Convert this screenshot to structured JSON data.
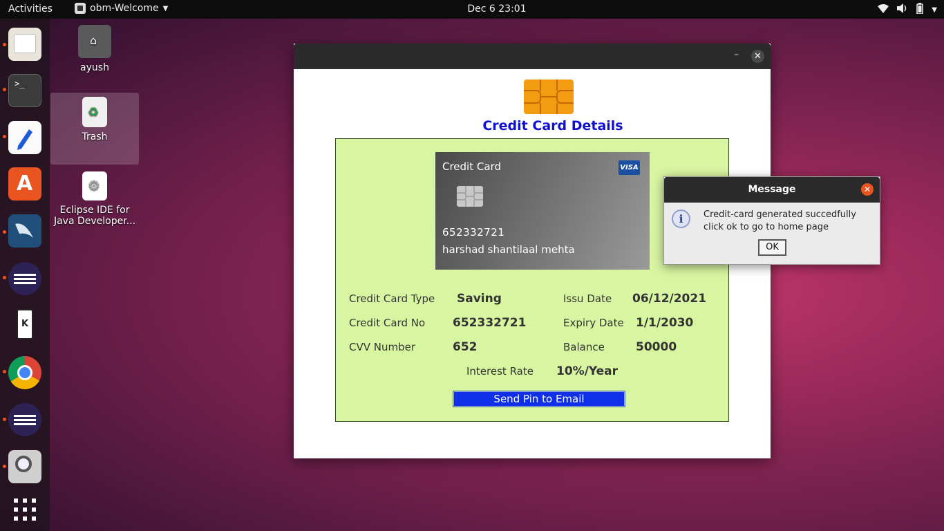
{
  "topbar": {
    "activities": "Activities",
    "app_name": "obm-Welcome",
    "clock": "Dec 6  23:01"
  },
  "desktop": {
    "icons": [
      {
        "label": "ayush",
        "icon": "home-folder-icon"
      },
      {
        "label": "Trash",
        "icon": "trash-icon"
      },
      {
        "label": "Eclipse IDE for Java Developer...",
        "icon": "eclipse-launcher-icon"
      }
    ]
  },
  "dock": {
    "items": [
      "files",
      "terminal",
      "text-editor",
      "software-center",
      "mysql-workbench",
      "eclipse",
      "kde-connect",
      "chrome",
      "eclipse",
      "screenshot",
      "show-applications"
    ]
  },
  "window": {
    "heading": "Credit Card Details",
    "card": {
      "title": "Credit Card",
      "brand": "VISA",
      "number": "652332721",
      "holder": "harshad shantilaal mehta"
    },
    "fields": {
      "type_label": "Credit Card Type",
      "type_value": "Saving",
      "number_label": "Credit Card No",
      "number_value": "652332721",
      "cvv_label": "CVV Number",
      "cvv_value": "652",
      "issue_label": "Issu Date",
      "issue_value": "06/12/2021",
      "expiry_label": "Expiry Date",
      "expiry_value": "1/1/2030",
      "balance_label": "Balance",
      "balance_value": "50000",
      "interest_label": "Interest Rate",
      "interest_value": "10%/Year"
    },
    "send_button": "Send Pin to Email"
  },
  "dialog": {
    "title": "Message",
    "line1": "Credit-card generated succedfully",
    "line2": "click ok to go to home page",
    "ok": "OK"
  },
  "colors": {
    "accent_orange": "#e95420",
    "heading_blue": "#1010d0",
    "panel_green": "#d8f5a2",
    "button_blue": "#1030e8"
  }
}
